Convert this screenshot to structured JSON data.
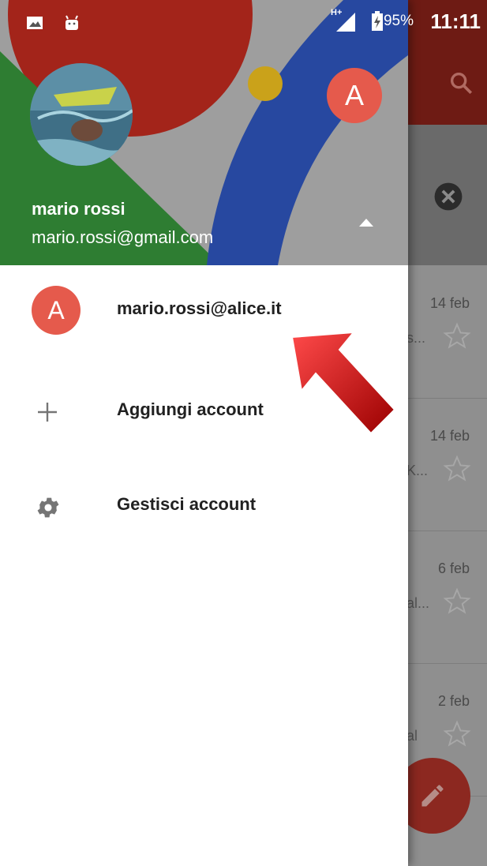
{
  "status_bar": {
    "battery_percent": "95%",
    "time": "11:11",
    "network": "H+"
  },
  "header": {
    "name": "mario rossi",
    "email": "mario.rossi@gmail.com",
    "other_account_initial": "A"
  },
  "accounts": [
    {
      "initial": "A",
      "email": "mario.rossi@alice.it"
    }
  ],
  "menu": {
    "add_account": "Aggiungi account",
    "manage_accounts": "Gestisci account"
  },
  "inbox_rows": [
    {
      "date": "14 feb",
      "snippet": "s..."
    },
    {
      "date": "14 feb",
      "snippet": "K..."
    },
    {
      "date": "6 feb",
      "snippet": "al..."
    },
    {
      "date": "2 feb",
      "snippet": "al"
    }
  ],
  "colors": {
    "header_red": "#a3241a",
    "header_green": "#2e7d32",
    "header_blue": "#2748a0",
    "header_yellow": "#caa21a",
    "avatar_red": "#e55a4c",
    "arrow_red": "#c40000"
  },
  "icons": [
    "image-icon",
    "android-icon",
    "signal-icon",
    "battery-charging-icon",
    "search-icon",
    "close-circle-icon",
    "caret-up-icon",
    "plus-icon",
    "gear-icon",
    "star-icon",
    "pencil-icon",
    "arrow-annotation"
  ]
}
